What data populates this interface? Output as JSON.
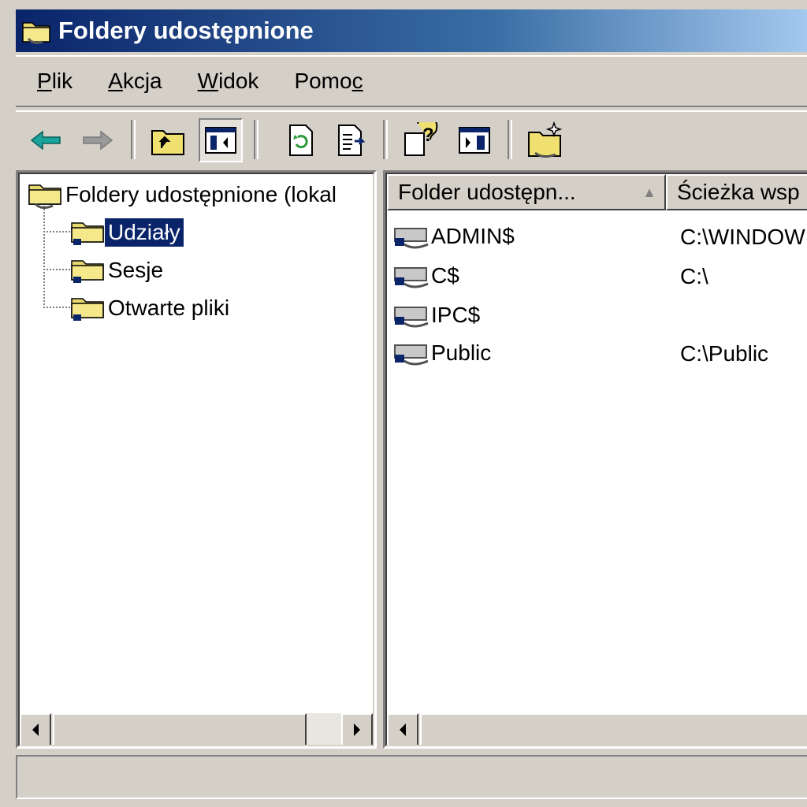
{
  "window": {
    "title": "Foldery udostępnione"
  },
  "menu": [
    {
      "pre": "",
      "key": "P",
      "post": "lik"
    },
    {
      "pre": "",
      "key": "A",
      "post": "kcja"
    },
    {
      "pre": "",
      "key": "W",
      "post": "idok"
    },
    {
      "pre": "Pomo",
      "key": "c",
      "post": ""
    }
  ],
  "toolbar": {
    "icons": [
      "back-arrow-icon",
      "forward-arrow-icon",
      "up-folder-icon",
      "show-hide-tree-icon",
      "refresh-icon",
      "export-list-icon",
      "help-icon",
      "show-hide-action-pane-icon",
      "new-share-icon"
    ]
  },
  "tree": {
    "root": "Foldery udostępnione (lokal",
    "children": [
      "Udziały",
      "Sesje",
      "Otwarte pliki"
    ],
    "selected": "Udziały"
  },
  "list": {
    "columns": [
      "Folder udostępn...",
      "Ścieżka wsp"
    ],
    "sort_indicator": "▲",
    "rows": [
      {
        "name": "ADMIN$",
        "path": "C:\\WINDOW"
      },
      {
        "name": "C$",
        "path": "C:\\"
      },
      {
        "name": "IPC$",
        "path": ""
      },
      {
        "name": "Public",
        "path": "C:\\Public"
      }
    ]
  },
  "colors": {
    "title_bar": "#0a246a",
    "selection": "#0a246a",
    "face": "#d4d0c8"
  }
}
